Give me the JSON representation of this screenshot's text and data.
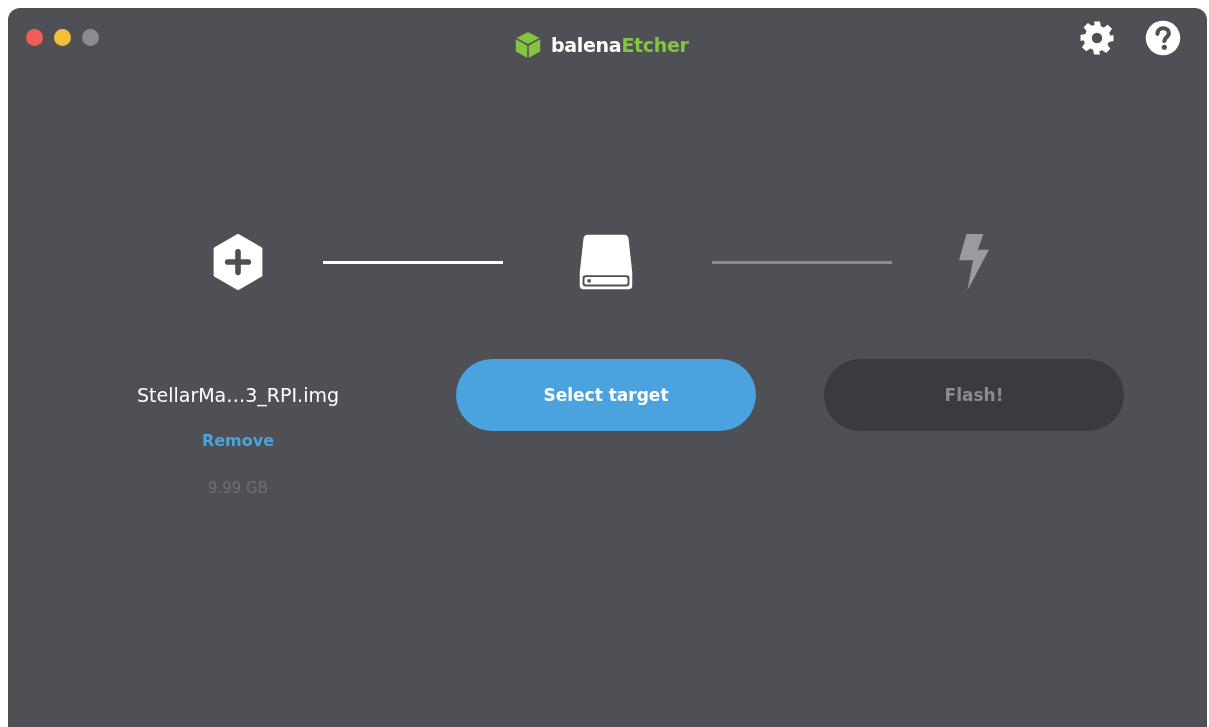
{
  "window": {
    "controls": [
      {
        "color": "#ee5f57"
      },
      {
        "color": "#f5bd3b"
      },
      {
        "color": "#8b8c90"
      }
    ],
    "title": [
      {
        "text": "balena",
        "kind": "plain"
      },
      {
        "text": "Etcher",
        "kind": "accent"
      }
    ]
  },
  "toolbar": [
    {
      "kind": "settings"
    },
    {
      "kind": "help"
    }
  ],
  "steps": [
    {
      "kind": "image",
      "active": true,
      "filename": "StellarMa…3_RPI.img",
      "link": "Remove",
      "size": "9.99 GB"
    },
    {
      "kind": "drive",
      "active": true,
      "button": {
        "label": "Select target",
        "disabled": false
      }
    },
    {
      "kind": "flash",
      "active": false,
      "button": {
        "label": "Flash!",
        "disabled": true
      }
    }
  ],
  "connectors": [
    {
      "done": true
    },
    {
      "done": false
    }
  ]
}
